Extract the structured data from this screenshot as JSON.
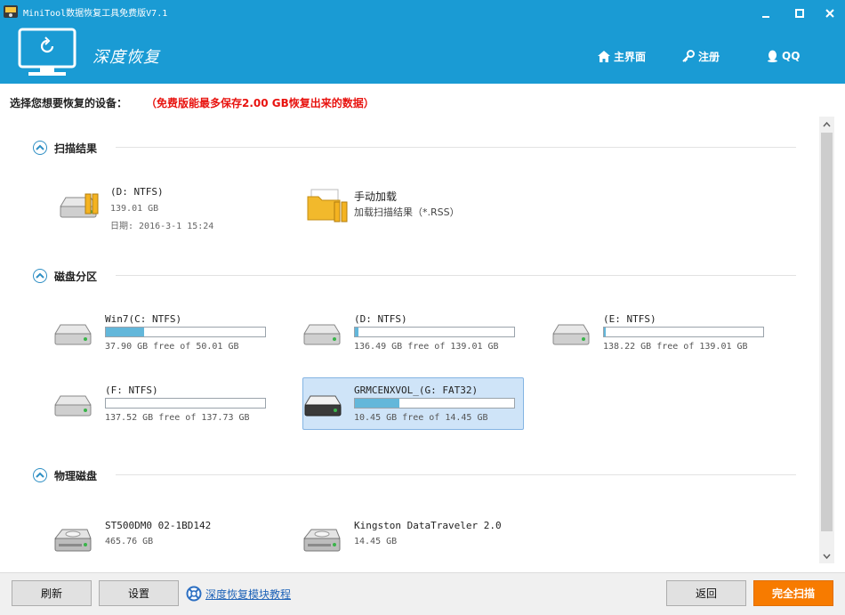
{
  "window": {
    "title": "MiniTool数据恢复工具免费版V7.1"
  },
  "header": {
    "module_title": "深度恢复",
    "nav": [
      {
        "label": "主界面",
        "icon": "home-icon"
      },
      {
        "label": "注册",
        "icon": "key-icon"
      },
      {
        "label": "QQ",
        "icon": "qq-icon"
      }
    ]
  },
  "hint": {
    "prompt": "选择您想要恢复的设备：",
    "limit_note": "（免费版能最多保存2.00 GB恢复出来的数据）"
  },
  "sections": {
    "scan_results": {
      "title": "扫描结果",
      "items": [
        {
          "name": "(D: NTFS)",
          "size": "139.01 GB",
          "date": "日期: 2016-3-1 15:24"
        },
        {
          "name": "手动加载",
          "sub": "加载扫描结果（*.RSS）"
        }
      ]
    },
    "partitions": {
      "title": "磁盘分区",
      "items": [
        {
          "name": "Win7(C: NTFS)",
          "free": "37.90 GB free of 50.01 GB",
          "used_fraction": 0.24
        },
        {
          "name": "(D: NTFS)",
          "free": "136.49 GB free of 139.01 GB",
          "used_fraction": 0.02
        },
        {
          "name": "(E: NTFS)",
          "free": "138.22 GB free of 139.01 GB",
          "used_fraction": 0.01
        },
        {
          "name": "(F: NTFS)",
          "free": "137.52 GB free of 137.73 GB",
          "used_fraction": 0.0
        },
        {
          "name": "GRMCENXVOL_(G: FAT32)",
          "free": "10.45 GB free of 14.45 GB",
          "used_fraction": 0.28,
          "selected": true
        }
      ]
    },
    "physical": {
      "title": "物理磁盘",
      "items": [
        {
          "name": "ST500DM0 02-1BD142",
          "size": "465.76 GB"
        },
        {
          "name": "Kingston DataTraveler 2.0",
          "size": "14.45 GB"
        }
      ]
    }
  },
  "footer": {
    "refresh": "刷新",
    "settings": "设置",
    "tutorial": "深度恢复模块教程",
    "back": "返回",
    "full_scan": "完全扫描"
  },
  "colors": {
    "header_bg": "#1a9bd4",
    "accent_orange": "#f77b00",
    "warning_red": "#e8130f",
    "usage_bar": "#63b7da",
    "selected_bg": "#cfe4f8"
  }
}
